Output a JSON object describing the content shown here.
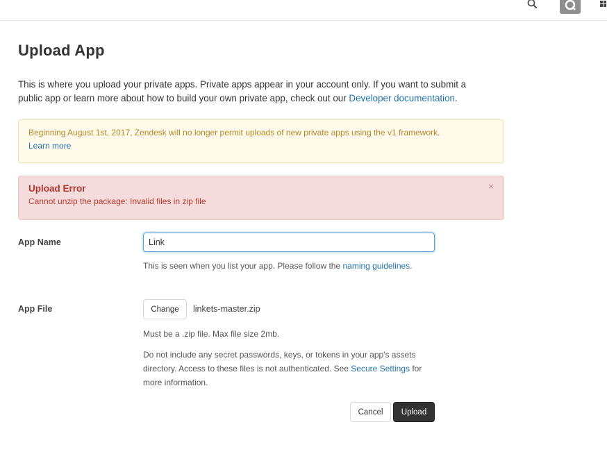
{
  "topbar": {
    "icons": [
      "search-icon",
      "profile-icon",
      "apps-grid-icon"
    ]
  },
  "page": {
    "title": "Upload App",
    "intro_text": "This is where you upload your private apps. Private apps appear in your account only. If you want to submit a public app or learn more about how to build your own private app, check out our ",
    "intro_link": "Developer documentation",
    "intro_end": "."
  },
  "warning": {
    "text": "Beginning August 1st, 2017, Zendesk will no longer permit uploads of new private apps using the v1 framework.",
    "link": "Learn more",
    "color": "#b9872a"
  },
  "error": {
    "title": "Upload Error",
    "message": "Cannot unzip the package: Invalid files in zip file",
    "close": "×",
    "color": "#b3352f"
  },
  "form": {
    "app_name_label": "App Name",
    "app_name_value": "Link",
    "app_name_hint_text": "This is seen when you list your app. Please follow the ",
    "app_name_hint_link": "naming guidelines",
    "app_name_hint_end": ".",
    "app_file_label": "App File",
    "change_button": "Change",
    "file_name": "linkets-master.zip",
    "file_hint": "Must be a .zip file. Max file size 2mb.",
    "secure_text": "Do not include any secret passwords, keys, or tokens in your app's assets directory. Access to these files is not authenticated. See ",
    "secure_link": "Secure Settings",
    "secure_end": " for more information.",
    "cancel_button": "Cancel",
    "upload_button": "Upload"
  },
  "colors": {
    "link": "#1f73b7",
    "primary_button": "#333333"
  }
}
